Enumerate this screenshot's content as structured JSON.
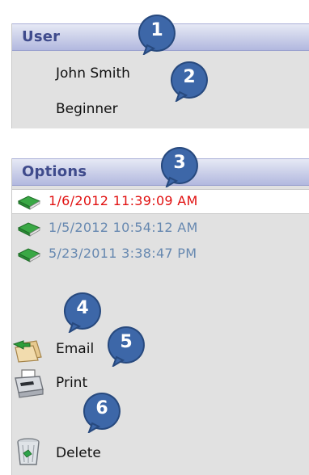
{
  "user_panel": {
    "title": "User",
    "name": "John Smith",
    "level": "Beginner"
  },
  "options_panel": {
    "title": "Options",
    "items": [
      {
        "label": "1/6/2012 11:39:09 AM",
        "selected": true
      },
      {
        "label": "1/5/2012 10:54:12 AM",
        "selected": false
      },
      {
        "label": "5/23/2011 3:38:47 PM",
        "selected": false
      }
    ]
  },
  "actions": {
    "email": "Email",
    "print": "Print",
    "delete": "Delete"
  },
  "callouts": [
    "1",
    "2",
    "3",
    "4",
    "5",
    "6"
  ],
  "colors": {
    "header_text": "#3f4b8c",
    "selected_text": "#e11111",
    "item_text": "#6688b0",
    "marker_fill": "#3d67a8"
  }
}
